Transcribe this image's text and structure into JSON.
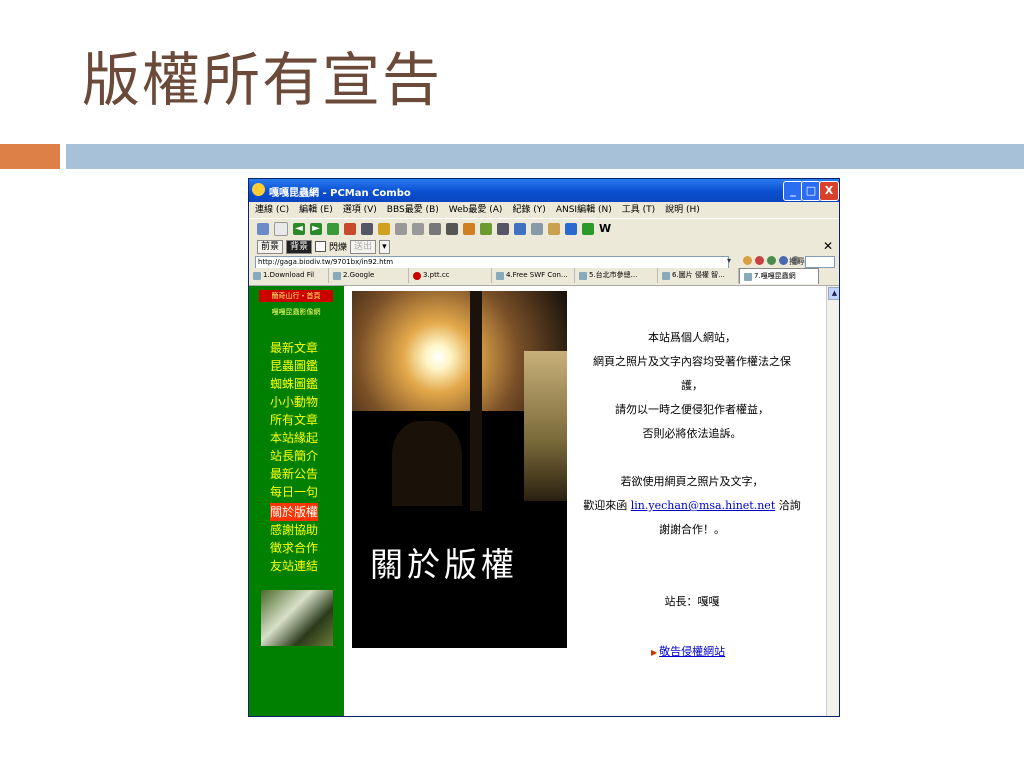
{
  "slide": {
    "title": "版權所有宣告"
  },
  "window": {
    "title": "嘎嘎昆蟲網 - PCMan Combo",
    "buttons": {
      "minimize": "_",
      "maximize": "□",
      "close": "X"
    }
  },
  "menu": [
    "連線 (C)",
    "編輯 (E)",
    "選項 (V)",
    "BBS最愛 (B)",
    "Web最愛 (A)",
    "紀錄 (Y)",
    "ANSI編輯 (N)",
    "工具 (T)",
    "說明 (H)"
  ],
  "toolbar2": {
    "foreground": "前景",
    "background": "背景",
    "blink": "閃爍",
    "send": "送出"
  },
  "address": {
    "url": "http://gaga.biodiv.tw/9701bx/in92.htm",
    "search_label": "搜尋："
  },
  "tabs": [
    "1.Download Fil",
    "2.Google",
    "3.ptt.cc",
    "4.Free SWF Con...",
    "5.台北市參總...",
    "6.圖片 侵權 智...",
    "7.嘎嘎昆蟲網"
  ],
  "sidebar": {
    "top_label": "簡奇山行・首頁",
    "sub_label": "嘎嘎昆蟲影像網",
    "items": [
      {
        "label": "最新文章"
      },
      {
        "label": "昆蟲圖鑑"
      },
      {
        "label": "蜘蛛圖鑑"
      },
      {
        "label": "小小動物"
      },
      {
        "label": "所有文章"
      },
      {
        "label": "本站緣起"
      },
      {
        "label": "站長簡介"
      },
      {
        "label": "最新公告"
      },
      {
        "label": "每日一句"
      },
      {
        "label": "關於版權"
      },
      {
        "label": "感謝協助"
      },
      {
        "label": "徵求合作"
      },
      {
        "label": "友站連結"
      }
    ]
  },
  "hero": {
    "text": "關於版權"
  },
  "notice": {
    "line1": "本站爲個人網站，",
    "line2": "網頁之照片及文字內容均受著作權法之保",
    "line3": "護，",
    "line4": "請勿以一時之便侵犯作者權益，",
    "line5": "否則必將依法追訴。",
    "line6": "若欲使用網頁之照片及文字，",
    "line7_pre": "歡迎來函",
    "email": "lin.yechan@msa.hinet.net",
    "line7_post": "洽詢",
    "line8": "謝謝合作！。",
    "signature": "站長：嘎嘎"
  },
  "warn_link": "敬告侵權網站",
  "colors": {
    "accent_orange": "#dd8047",
    "accent_blue": "#a6c1d8",
    "nav_green": "#008000"
  }
}
